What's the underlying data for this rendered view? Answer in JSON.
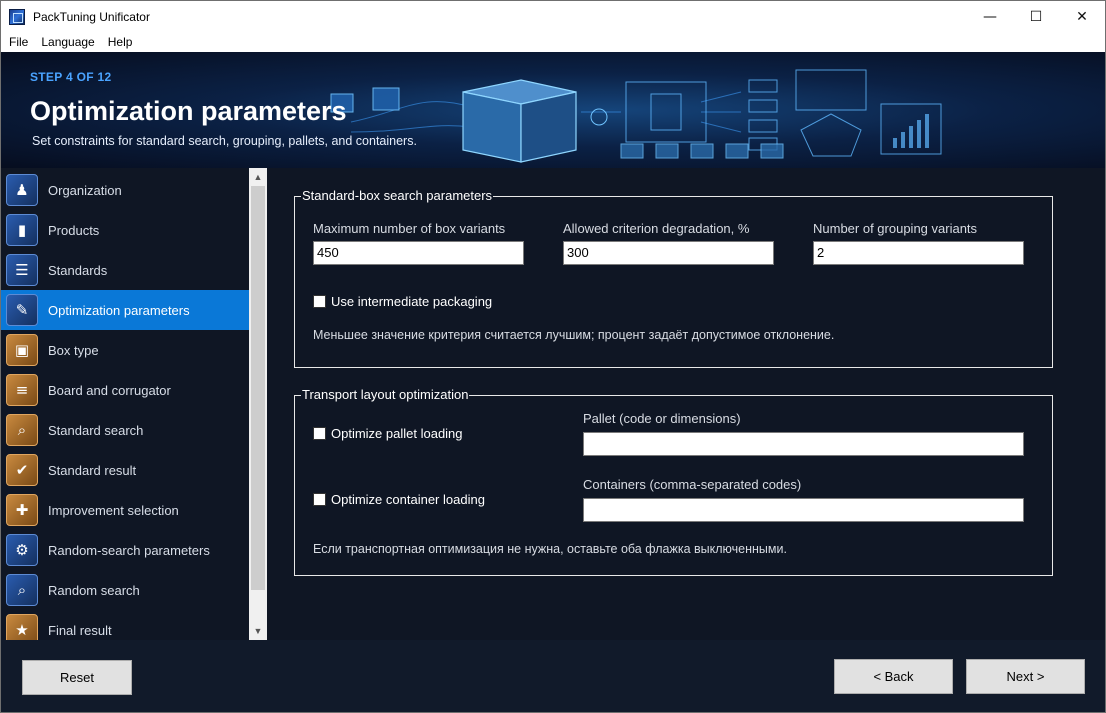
{
  "window": {
    "title": "PackTuning Unificator",
    "controls": {
      "minimize": "—",
      "maximize": "☐",
      "close": "✕"
    }
  },
  "menu": [
    "File",
    "Language",
    "Help"
  ],
  "header": {
    "step": "STEP 4 OF 12",
    "title": "Optimization parameters",
    "subtitle": "Set constraints for standard search, grouping, pallets, and containers."
  },
  "sidebar": {
    "items": [
      {
        "label": "Organization",
        "icon": "organization-icon",
        "active": false
      },
      {
        "label": "Products",
        "icon": "products-icon",
        "active": false
      },
      {
        "label": "Standards",
        "icon": "standards-icon",
        "active": false
      },
      {
        "label": "Optimization parameters",
        "icon": "optimization-icon",
        "active": true
      },
      {
        "label": "Box type",
        "icon": "box-type-icon",
        "active": false
      },
      {
        "label": "Board and corrugator",
        "icon": "board-icon",
        "active": false
      },
      {
        "label": "Standard search",
        "icon": "standard-search-icon",
        "active": false
      },
      {
        "label": "Standard result",
        "icon": "standard-result-icon",
        "active": false
      },
      {
        "label": "Improvement selection",
        "icon": "improvement-icon",
        "active": false
      },
      {
        "label": "Random-search parameters",
        "icon": "random-params-icon",
        "active": false
      },
      {
        "label": "Random search",
        "icon": "random-search-icon",
        "active": false
      },
      {
        "label": "Final result",
        "icon": "final-result-icon",
        "active": false
      }
    ]
  },
  "standard_box": {
    "title": "Standard-box search parameters",
    "max_variants_label": "Maximum number of box variants",
    "max_variants_value": "450",
    "degradation_label": "Allowed criterion degradation, %",
    "degradation_value": "300",
    "grouping_label": "Number of grouping variants",
    "grouping_value": "2",
    "intermediate_label": "Use intermediate packaging",
    "intermediate_checked": false,
    "note": "Меньшее значение критерия считается лучшим; процент задаёт допустимое отклонение."
  },
  "transport": {
    "title": "Transport layout optimization",
    "pallet_check_label": "Optimize pallet loading",
    "pallet_checked": false,
    "pallet_field_label": "Pallet (code or dimensions)",
    "pallet_value": "",
    "container_check_label": "Optimize container loading",
    "container_checked": false,
    "container_field_label": "Containers (comma-separated codes)",
    "container_value": "",
    "note": "Если транспортная оптимизация не нужна, оставьте оба флажка выключенными."
  },
  "buttons": {
    "reset": "Reset",
    "back": "< Back",
    "next": "Next >"
  },
  "colors": {
    "accent": "#0a78d7",
    "step": "#4aa3ff",
    "background": "#0f1624"
  }
}
